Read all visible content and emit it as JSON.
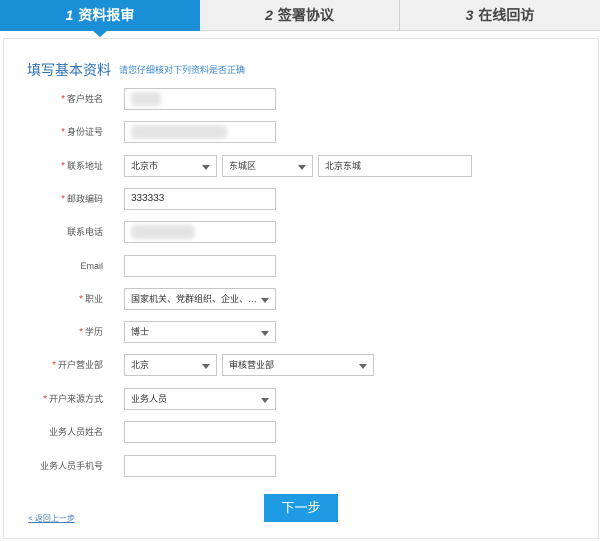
{
  "steps": [
    {
      "num": "1",
      "label": "资料报审"
    },
    {
      "num": "2",
      "label": "签署协议"
    },
    {
      "num": "3",
      "label": "在线回访"
    }
  ],
  "form": {
    "title": "填写基本资料",
    "hint": "请您仔细核对下列资料是否正确",
    "customer_name": {
      "label": "客户姓名",
      "value": ""
    },
    "id_number": {
      "label": "身份证号",
      "value": ""
    },
    "address": {
      "label": "联系地址",
      "city": "北京市",
      "district": "东城区",
      "detail": "北京东城"
    },
    "postcode": {
      "label": "邮政编码",
      "value": "333333"
    },
    "phone": {
      "label": "联系电话",
      "value": ""
    },
    "email": {
      "label": "Email",
      "value": ""
    },
    "occupation": {
      "label": "职业",
      "selected": "国家机关、党群组织、企业、…"
    },
    "education": {
      "label": "学历",
      "selected": "博士"
    },
    "branch": {
      "label": "开户营业部",
      "city": "北京",
      "office": "审核营业部"
    },
    "source": {
      "label": "开户来源方式",
      "selected": "业务人员"
    },
    "staff_name": {
      "label": "业务人员姓名",
      "value": ""
    },
    "staff_phone": {
      "label": "业务人员手机号",
      "value": ""
    }
  },
  "actions": {
    "next_label": "下一步",
    "back_label": "< 返回上一步"
  },
  "colors": {
    "accent": "#1b8fd6",
    "required": "#e03a2c",
    "title": "#2a6fb6"
  }
}
